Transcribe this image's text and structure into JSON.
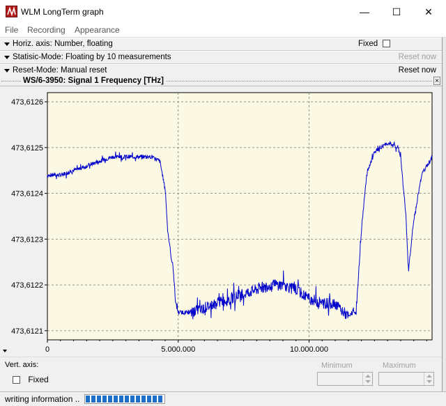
{
  "window": {
    "title": "WLM LongTerm graph",
    "minimize_glyph": "—",
    "maximize_glyph": "☐",
    "close_glyph": "✕"
  },
  "menu": [
    "File",
    "Recording",
    "Appearance"
  ],
  "options": {
    "horiz_axis": "Horiz. axis: Number,  floating",
    "fixed_label": "Fixed",
    "fixed_checked": false,
    "statistic_mode": "Statisic-Mode: Floating by 10 measurements",
    "reset_now_disabled": "Reset now",
    "reset_mode": "Reset-Mode: Manual reset",
    "reset_now": "Reset now"
  },
  "graph": {
    "title": "WS/6-3950: Signal 1  Frequency  [THz]",
    "close_glyph": "×"
  },
  "chart_data": {
    "type": "line",
    "series_color": "#0000cc",
    "plot_background": "#fbf9e3",
    "y_ticks": [
      "473,6126",
      "473,6125",
      "473,6124",
      "473,6123",
      "473,6122",
      "473,6121"
    ],
    "y_tick_values": [
      473.6126,
      473.6125,
      473.6124,
      473.6123,
      473.6122,
      473.6121
    ],
    "x_ticks": [
      "0",
      "5.000.000",
      "10.000.000"
    ],
    "x_tick_values": [
      0,
      5000000,
      10000000
    ],
    "ylim": [
      473.61208,
      473.61262
    ],
    "xlim": [
      0,
      14700000
    ],
    "grid": true,
    "x": [
      0,
      500000,
      1000000,
      1500000,
      2000000,
      2500000,
      3000000,
      3500000,
      4000000,
      4300000,
      4500000,
      4600000,
      4700000,
      4800000,
      4900000,
      5000000,
      5500000,
      6000000,
      6500000,
      7000000,
      7500000,
      8000000,
      8500000,
      9000000,
      9500000,
      10000000,
      10500000,
      11000000,
      11500000,
      11700000,
      11800000,
      12000000,
      12200000,
      12500000,
      13000000,
      13400000,
      13500000,
      13700000,
      13800000,
      14000000,
      14300000,
      14700000
    ],
    "y": [
      473.61244,
      473.61244,
      473.61245,
      473.61246,
      473.61247,
      473.61248,
      473.61248,
      473.61248,
      473.61248,
      473.61247,
      473.61241,
      473.61232,
      473.61227,
      473.61224,
      473.61216,
      473.61214,
      473.61214,
      473.61215,
      473.61216,
      473.61217,
      473.61218,
      473.61219,
      473.6122,
      473.6122,
      473.61219,
      473.61217,
      473.61216,
      473.61216,
      473.61213,
      473.61214,
      473.61214,
      473.61232,
      473.61244,
      473.61249,
      473.61251,
      473.6125,
      473.61248,
      473.61235,
      473.61223,
      473.61234,
      473.61244,
      473.61248
    ]
  },
  "vertical_axis": {
    "label": "Vert. axis:",
    "fixed_label": "Fixed",
    "fixed_checked": false,
    "minimum_label": "Minimum",
    "maximum_label": "Maximum"
  },
  "status": {
    "text": "writing information ..",
    "progress_fraction": 0.98
  }
}
